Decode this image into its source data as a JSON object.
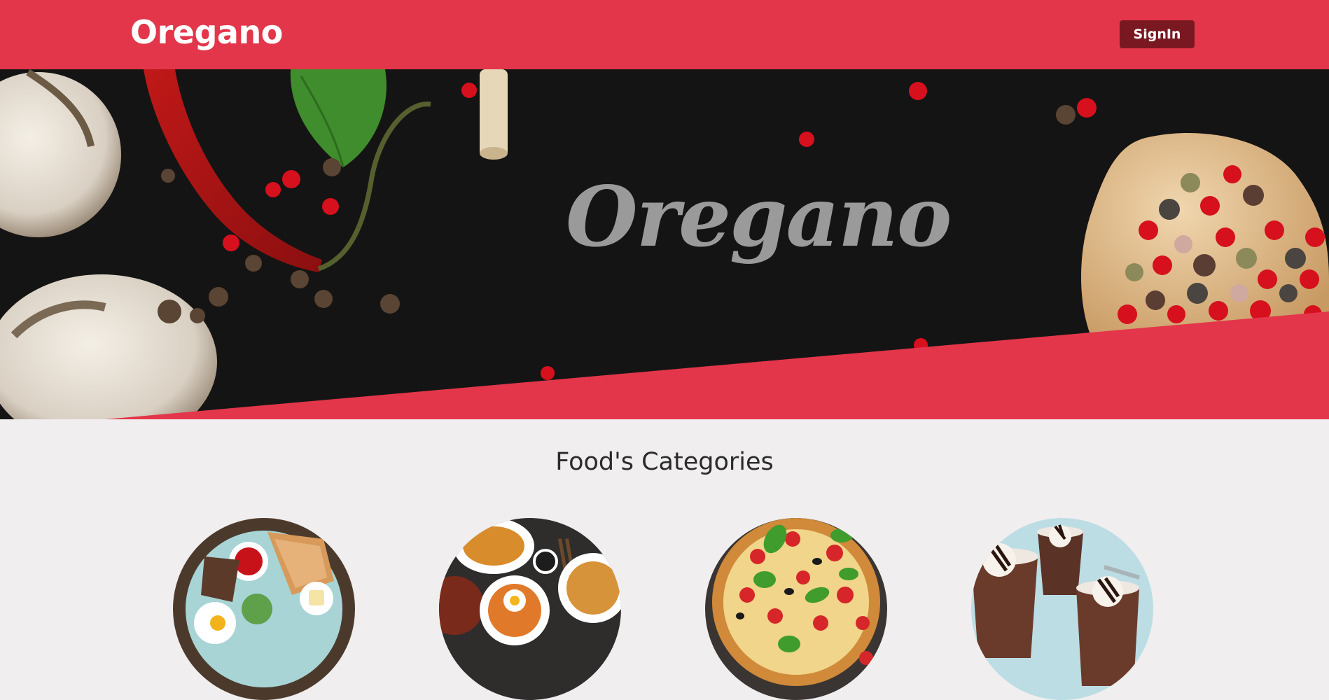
{
  "navbar": {
    "brand": "Oregano",
    "signin_label": "SignIn"
  },
  "hero": {
    "title": "Oregano",
    "accent_color": "#e3364a",
    "background_color": "#151414"
  },
  "categories_section": {
    "title": "Food's Categories",
    "items": [
      {
        "image": "breakfast-plate"
      },
      {
        "image": "noodles-and-meatballs"
      },
      {
        "image": "pizza"
      },
      {
        "image": "chocolate-mousse"
      }
    ]
  },
  "colors": {
    "nav_bg": "#e3364a",
    "signin_bg": "#7a1822",
    "page_bg": "#f0eeef"
  }
}
